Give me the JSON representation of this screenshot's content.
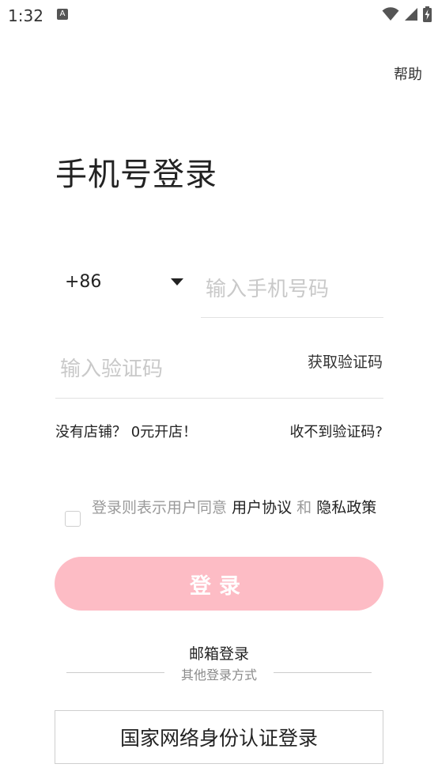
{
  "status_bar": {
    "time": "1:32",
    "app_icon_letter": "A"
  },
  "header": {
    "help_label": "帮助"
  },
  "title": "手机号登录",
  "form": {
    "country_code": "+86",
    "phone_placeholder": "输入手机号码",
    "code_placeholder": "输入验证码",
    "get_code_label": "获取验证码",
    "no_store_label": "没有店铺？ 0元开店！",
    "no_code_label": "收不到验证码?"
  },
  "agreement": {
    "prefix": "登录则表示用户同意",
    "user_agreement": "用户协议",
    "and": "和",
    "privacy_policy": "隐私政策",
    "checked": false
  },
  "login_button": "登录",
  "email_login": "邮箱登录",
  "other_methods": "其他登录方式",
  "national_id_login": "国家网络身份认证登录",
  "colors": {
    "login_button_bg": "#fdbcc5",
    "placeholder": "#c9c9c9",
    "muted_text": "#9a9a9a"
  }
}
